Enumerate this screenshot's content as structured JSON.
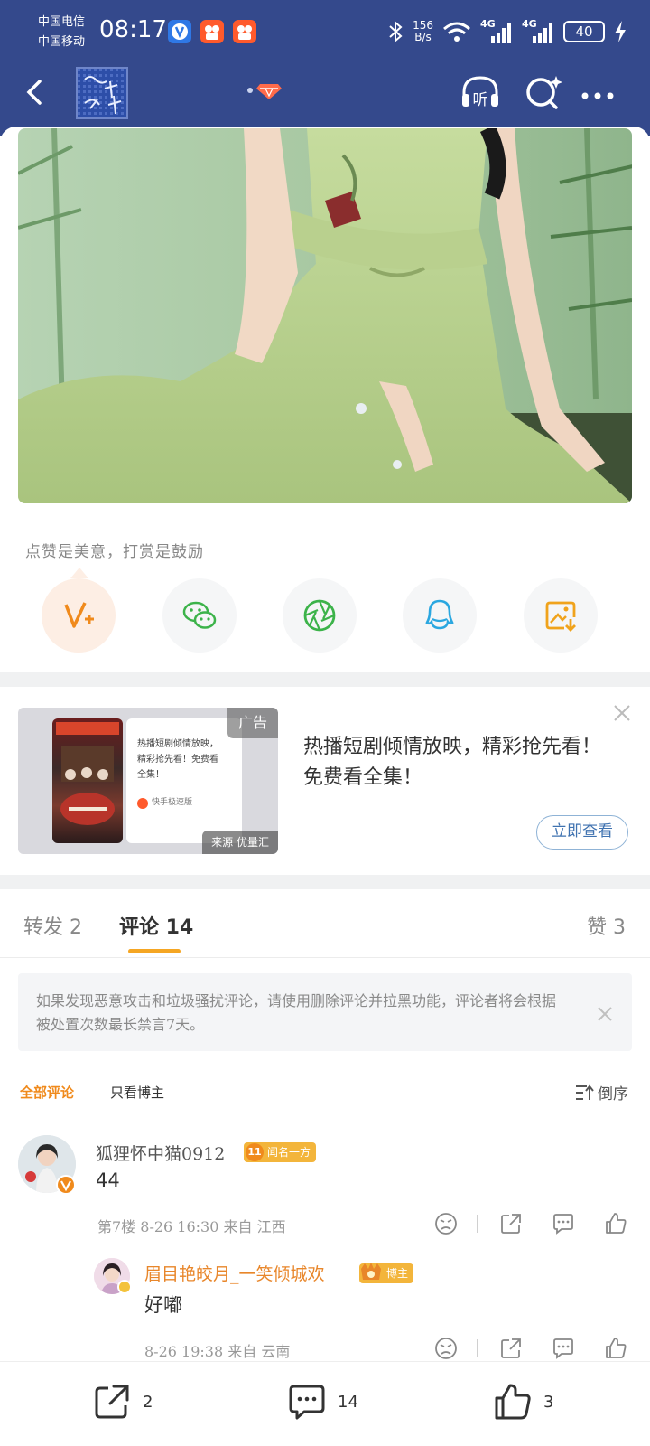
{
  "status_bar": {
    "carrier1": "中国电信",
    "carrier2": "中国移动",
    "time": "08:17",
    "net_speed_value": "156",
    "net_speed_unit": "B/s",
    "signal1": "4G",
    "signal2": "4G",
    "battery": "40"
  },
  "nav": {
    "listen_label": "听"
  },
  "share": {
    "tip": "点赞是美意，打赏是鼓励"
  },
  "ad": {
    "tag": "广告",
    "source": "来源 优量汇",
    "card_text_1": "热播短剧倾情放映，",
    "card_text_2": "精彩抢先看！免费看",
    "card_text_3": "全集！",
    "card_brand": "快手极速版",
    "headline": "热播短剧倾情放映，精彩抢先看！免费看全集！",
    "button": "立即查看"
  },
  "tabs": [
    {
      "label": "转发 2"
    },
    {
      "label": "评论 14"
    },
    {
      "label": "赞 3"
    }
  ],
  "notice": "如果发现恶意攻击和垃圾骚扰评论，请使用删除评论并拉黑功能，评论者将会根据被处置次数最长禁言7天。",
  "filters": {
    "all": "全部评论",
    "owner_only": "只看博主",
    "sort": "倒序"
  },
  "comments": [
    {
      "user": "狐狸怀中猫0912",
      "badge_level": "11",
      "badge_text": "闻名一方",
      "text": "44",
      "meta": "第7楼 8-26 16:30 来自 江西"
    },
    {
      "user": "眉目艳皎月_一笑倾城欢",
      "badge_text": "博主",
      "text": "好嘟",
      "meta": "8-26 19:38 来自 云南"
    }
  ],
  "bottom": {
    "repost_count": "2",
    "comment_count": "14",
    "like_count": "3"
  },
  "colors": {
    "header": "#34498c",
    "accent_orange": "#f5a623",
    "badge_orange": "#f3b53b"
  }
}
